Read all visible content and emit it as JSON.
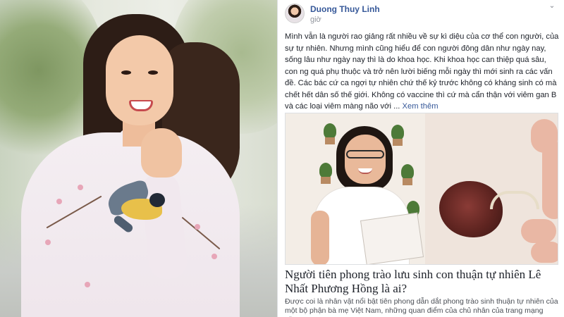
{
  "post": {
    "author_name": "Duong Thuy Linh",
    "time": "giờ",
    "text": "Mình vẫn là người rao giảng rất nhiều về sự kì diệu của cơ thể con người, của sự tự nhiên. Nhưng mình cũng hiểu để con người đông dân như ngày nay, sống lâu như ngày nay thì là do khoa học. Khi khoa học can thiệp quá sâu, con ng quá phụ thuộc và trở nên lười biếng mỗi ngày thì mới sinh ra các vấn đề. Các bác cứ ca ngợi tự nhiên chứ thế kỷ trước không có kháng sinh có mà chết hết dân số thế giới. Không có vaccine thì cứ mà cẩn thận với viêm gan B và các loại viêm màng não với ...",
    "see_more": "Xem thêm",
    "options_icon": "more-options-icon"
  },
  "link_preview": {
    "title": "Người tiên phong trào lưu sinh con thuận tự nhiên Lê Nhất Phương Hồng là ai?",
    "description": "Được coi là nhân vật nổi bật tiên phong dẫn dắt phong trào sinh thuận tự nhiên của một bộ phận bà mẹ Việt Nam, những quan điểm của chủ nhân của trang mạng xã..."
  },
  "colors": {
    "author_link": "#365899",
    "body_text": "#1d2129",
    "muted_text": "#90949c",
    "border": "#dddfe2"
  }
}
